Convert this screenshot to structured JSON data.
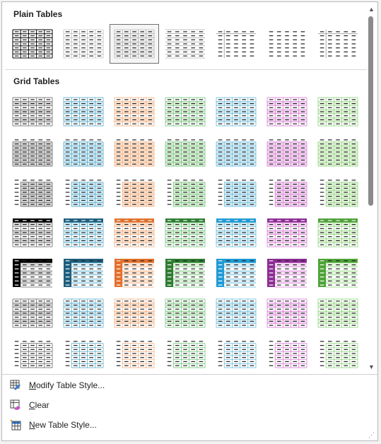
{
  "sections": {
    "plain": {
      "title": "Plain Tables"
    },
    "grid": {
      "title": "Grid Tables"
    }
  },
  "colors": {
    "palette": [
      "#595959",
      "#4aa3c4",
      "#f1a46f",
      "#5fbf6a",
      "#5ab4d6",
      "#d46ad0",
      "#7fcf6c"
    ],
    "palette_fill": [
      "#d9d9d9",
      "#d6eef8",
      "#fde5d3",
      "#dff1db",
      "#d8eff8",
      "#f5dcf4",
      "#e7f6df"
    ],
    "palette_dark": [
      "#000000",
      "#1f5e7c",
      "#e2702a",
      "#2e7d32",
      "#1e9bd6",
      "#8e2d95",
      "#4ea337"
    ]
  },
  "menu": [
    {
      "id": "modify",
      "icon": "modify-table-style-icon",
      "accel": "M",
      "rest": "odify Table Style..."
    },
    {
      "id": "clear",
      "icon": "clear-eraser-icon",
      "accel": "C",
      "rest": "lear"
    },
    {
      "id": "new",
      "icon": "new-table-style-icon",
      "accel": "N",
      "rest": "ew Table Style..."
    }
  ],
  "scrollbar": {
    "up_icon": "▲",
    "down_icon": "▼"
  },
  "resize_grip": "⋰"
}
